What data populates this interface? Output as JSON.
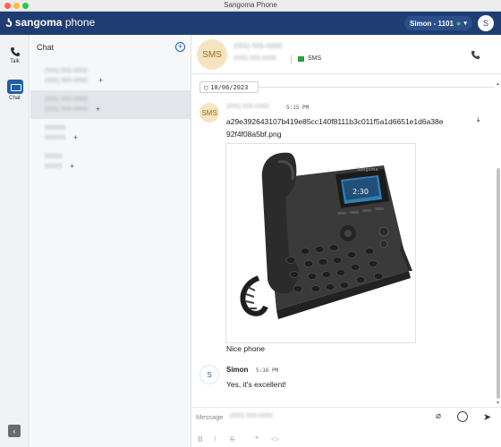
{
  "window": {
    "title": "Sangoma Phone"
  },
  "appbar": {
    "brand": "sangoma",
    "brand_suffix": "phone",
    "user_label": "Simon - 1101",
    "avatar_initial": "S"
  },
  "rail": {
    "talk_label": "Talk",
    "chat_label": "Chat"
  },
  "sidebar": {
    "title": "Chat",
    "conversations": [
      {
        "line1": "(555) 555-0000",
        "line2": "(555) 555-0000",
        "selected": false
      },
      {
        "line1": "(555) 555-0000",
        "line2": "(555) 555-0000",
        "selected": true
      },
      {
        "line1": "555555",
        "line2": "555555",
        "selected": false
      },
      {
        "line1": "55555",
        "line2": "55555",
        "selected": false
      }
    ]
  },
  "header": {
    "avatar_text": "SMS",
    "contact_name": "(555) 555-0000",
    "contact_number": "(555) 555-0000",
    "channel": "SMS"
  },
  "messages": {
    "date": "10/06/2023",
    "first": {
      "avatar": "SMS",
      "sender": "(555) 555-0000",
      "time": "5:15 PM",
      "file_name_line1": "a29e392643107b419e85cc140f8111b3c011f5a1d6651e1d6a38e",
      "file_name_line2": "92f4f08a5bf.png",
      "caption": "Nice phone"
    },
    "second": {
      "avatar": "S",
      "sender": "Simon",
      "time": "5:16 PM",
      "text": "Yes, it's excellent!"
    }
  },
  "phone_screen_time": "2:30",
  "phone_brand": "Sangoma",
  "composer": {
    "label": "Message",
    "number": "(555) 555-0000"
  }
}
